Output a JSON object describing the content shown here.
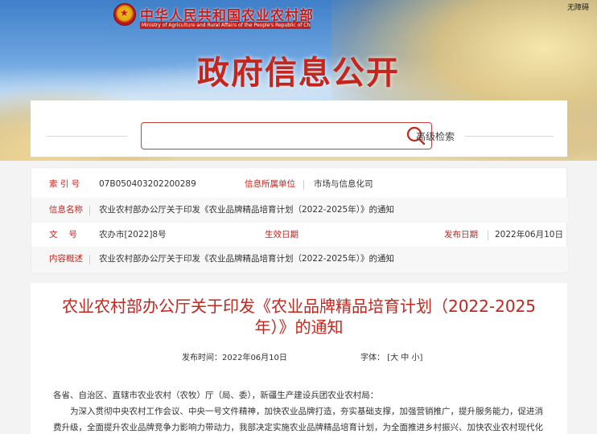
{
  "header": {
    "ministry_cn": "中华人民共和国农业农村部",
    "ministry_en": "Ministry of Agriculture and Rural Affairs of the People's Republic of China",
    "accessibility": "无障碍",
    "page_heading": "政府信息公开",
    "brand_color": "#c4261e"
  },
  "search": {
    "placeholder": "",
    "value": "",
    "button_icon": "search-icon",
    "advanced_label": "高级检索"
  },
  "meta": {
    "index_label": "索 引 号",
    "index_value": "07B050403202200289",
    "unit_label": "信息所属单位",
    "unit_value": "市场与信息化司",
    "name_label": "信息名称",
    "name_value": "农业农村部办公厅关于印发《农业品牌精品培育计划（2022-2025年）》的通知",
    "doc_label": "文　 号",
    "doc_value": "农办市[2022]8号",
    "effective_label": "生效日期",
    "effective_value": "",
    "publish_label": "发布日期",
    "publish_value": "2022年06月10日",
    "summary_label": "内容概述",
    "summary_value": "农业农村部办公厅关于印发《农业品牌精品培育计划（2022-2025年）》的通知"
  },
  "article": {
    "title": "农业农村部办公厅关于印发《农业品牌精品培育计划（2022-2025年）》的通知",
    "date_label": "发布时间：",
    "date_value": "2022年06月10日",
    "font_label": "字体：",
    "font_open": "[",
    "font_large": "大",
    "font_medium": "中",
    "font_small": "小",
    "font_close": "]",
    "para1": "各省、自治区、直辖市农业农村（农牧）厅（局、委），新疆生产建设兵团农业农村局：",
    "para2": "为深入贯彻中央农村工作会议、中央一号文件精神，加快农业品牌打造，夯实基础支撑，加强营销推广，提升服务能力，促进消费升级，全面提升农业品牌竞争力影响力带动力，我部决定实施农业品牌精品培育计划，为全面推进乡村振兴、加快农业农村现代化"
  }
}
